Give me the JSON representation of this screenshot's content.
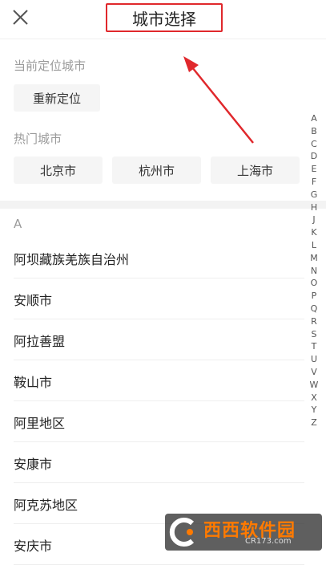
{
  "header": {
    "title": "城市选择"
  },
  "current_location": {
    "label": "当前定位城市",
    "button": "重新定位"
  },
  "hot_cities": {
    "label": "热门城市",
    "items": [
      "北京市",
      "杭州市",
      "上海市"
    ]
  },
  "list": {
    "letter": "A",
    "items": [
      "阿坝藏族羌族自治州",
      "安顺市",
      "阿拉善盟",
      "鞍山市",
      "阿里地区",
      "安康市",
      "阿克苏地区",
      "安庆市"
    ]
  },
  "alphabet": [
    "A",
    "B",
    "C",
    "D",
    "E",
    "F",
    "G",
    "H",
    "J",
    "K",
    "L",
    "M",
    "N",
    "O",
    "P",
    "Q",
    "R",
    "S",
    "T",
    "U",
    "V",
    "W",
    "X",
    "Y",
    "Z"
  ],
  "colors": {
    "annotation_red": "#e0282c",
    "chip_bg": "#f5f5f5"
  },
  "watermark": {
    "name": "西西软件园",
    "domain": "CR173.com"
  }
}
